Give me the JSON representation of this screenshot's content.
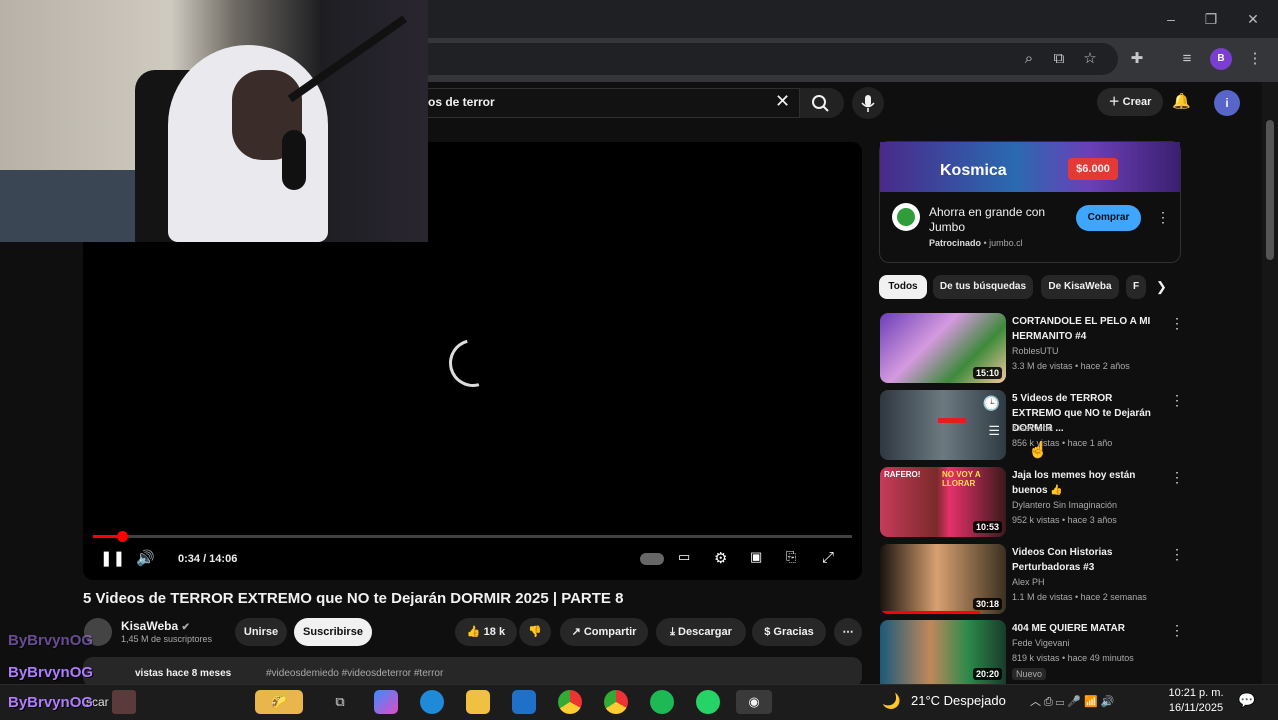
{
  "browser": {
    "window_controls": {
      "minimize": "–",
      "restore": "❐",
      "close": "✕"
    },
    "toolbar_icons": [
      "zoom-icon",
      "install-icon",
      "bookmark-star-icon",
      "extensions-icon",
      "media-icon",
      "profile-icon",
      "menu-icon"
    ],
    "profile_letter": "B"
  },
  "youtube": {
    "search": {
      "value": "os de terror"
    },
    "header": {
      "create_label": "Crear",
      "avatar_letter": "i"
    },
    "player": {
      "time": "0:34 / 14:06",
      "progress": 0.04
    },
    "video": {
      "title": "5 Videos de TERROR EXTREMO que NO te Dejarán DORMIR 2025 | PARTE 8",
      "channel": "KisaWeba",
      "subscribers": "1,45 M de suscriptores",
      "join_label": "Unirse",
      "subscribe_label": "Suscribirse",
      "likes": "18 k",
      "share_label": "Compartir",
      "download_label": "Descargar",
      "thanks_label": "Gracias",
      "description_views": "vistas",
      "description_age": "hace 8 meses",
      "description_tags": "#videosdemiedo #videosdeterror #terror"
    },
    "ad": {
      "banner_text": "Kosmica",
      "banner_price": "$6.000",
      "title": "Ahorra en grande con Jumbo",
      "sponsored": "Patrocinado",
      "domain": "jumbo.cl",
      "button": "Comprar"
    },
    "chips": [
      "Todos",
      "De tus búsquedas",
      "De KisaWeba",
      "F"
    ],
    "related": [
      {
        "title": "CORTANDOLE EL PELO A MI HERMANITO #4",
        "channel": "RoblesUTU",
        "meta": "3.3 M de vistas • hace 2 años",
        "duration": "15:10"
      },
      {
        "title": "5 Videos de TERROR EXTREMO que NO te Dejarán DORMIR ...",
        "channel": "KisaWeba",
        "meta": "856 k vistas • hace 1 año",
        "duration": ""
      },
      {
        "title": "Jaja los memes hoy están buenos 👍",
        "channel": "Dylantero Sin Imaginación",
        "meta": "952 k vistas • hace 3 años",
        "duration": "10:53"
      },
      {
        "title": "Videos Con Historias Perturbadoras #3",
        "channel": "Alex PH",
        "meta": "1.1 M de vistas • hace 2 semanas",
        "duration": "30:18"
      },
      {
        "title": "404 ME QUIERE MATAR",
        "channel": "Fede Vigevani",
        "meta": "819 k vistas • hace 49 minutos",
        "duration": "20:20",
        "badge": "Nuevo"
      }
    ],
    "thumb_text": {
      "t3a": "RAFERO!",
      "t3b": "NO VOY A LLORAR"
    }
  },
  "overlay": {
    "handles": [
      "ByBrvynOG",
      "ByBrvynOG",
      "ByBrvynOG"
    ]
  },
  "taskbar": {
    "weather": "21°C  Despejado",
    "time": "10:21 p. m.",
    "date": "16/11/2025",
    "search_fragment": "scar"
  },
  "colors": {
    "accent_red": "#ff0000",
    "youtube_bg": "#0f0f0f",
    "overlay_purple": "#b07cff",
    "subscribe_blue": "#3ea6ff"
  }
}
